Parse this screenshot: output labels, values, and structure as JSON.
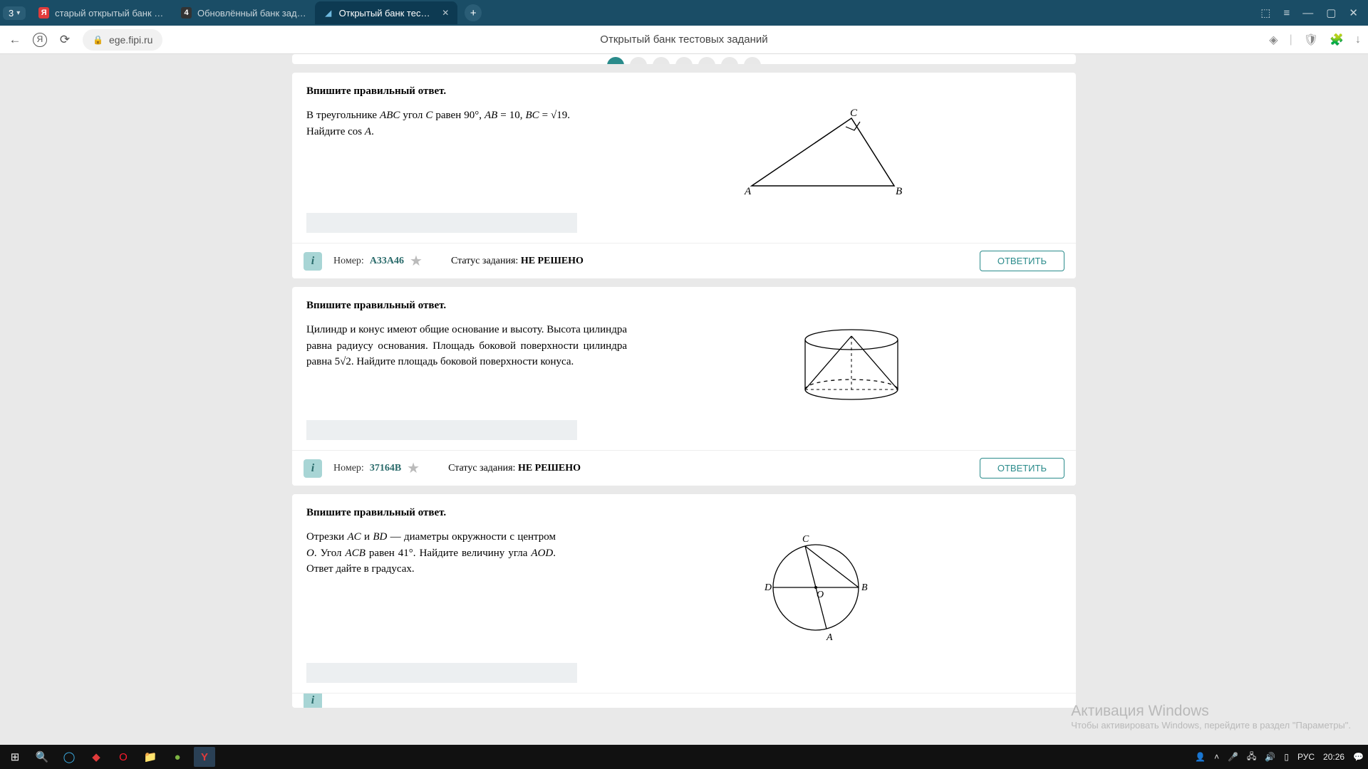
{
  "browser": {
    "tab_counter": "3",
    "tabs": [
      {
        "favicon": "Я",
        "favicon_bg": "#e13b3b",
        "title": "старый открытый банк за…",
        "active": false
      },
      {
        "favicon": "4",
        "favicon_bg": "#333",
        "title": "Обновлённый банк задан…",
        "active": false
      },
      {
        "favicon": "◢",
        "favicon_bg": "#1a6b9b",
        "title": "Открытый банк тестовы…",
        "active": true
      }
    ],
    "url": "ege.fipi.ru",
    "page_title": "Открытый банк тестовых заданий"
  },
  "tasks": [
    {
      "title": "Впишите правильный ответ.",
      "text_html": "В треугольнике <span class='it'>ABC</span> угол <span class='it'>C</span> равен 90°, <span class='it'>AB</span> = 10, <span class='it'>BC</span> = √19. Найдите cos <span class='it'>A</span>.",
      "figure": "triangle",
      "number": "A33A46",
      "status": "НЕ РЕШЕНО",
      "answer_label": "ОТВЕТИТЬ"
    },
    {
      "title": "Впишите правильный ответ.",
      "text_html": "Цилиндр и конус имеют общие основание и высоту. Высота цилиндра равна радиусу основания. Площадь боковой поверхности цилиндра равна 5√2. Найдите площадь боковой поверхности конуса.",
      "figure": "cylinder-cone",
      "number": "37164B",
      "status": "НЕ РЕШЕНО",
      "answer_label": "ОТВЕТИТЬ"
    },
    {
      "title": "Впишите правильный ответ.",
      "text_html": "Отрезки <span class='it'>AC</span> и <span class='it'>BD</span> — диаметры окружности с центром <span class='it'>O</span>. Угол <span class='it'>ACB</span> равен 41°. Найдите величину угла <span class='it'>AOD</span>. Ответ дайте в градусах.",
      "figure": "circle",
      "number": "",
      "status": "",
      "answer_label": ""
    }
  ],
  "meta_labels": {
    "number_prefix": "Номер:",
    "status_prefix": "Статус задания:"
  },
  "watermark": {
    "line1": "Активация Windows",
    "line2": "Чтобы активировать Windows, перейдите в раздел \"Параметры\"."
  },
  "taskbar": {
    "lang": "РУС",
    "time": "20:26"
  }
}
